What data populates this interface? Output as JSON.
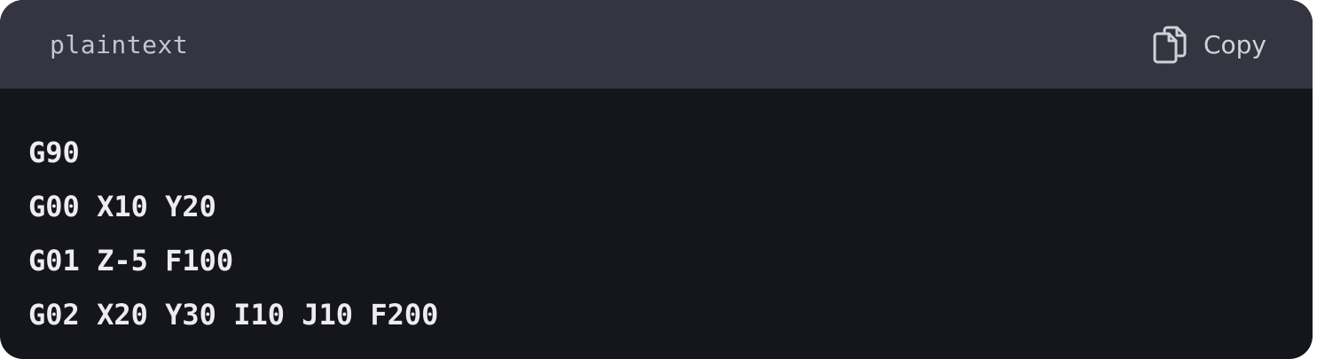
{
  "header": {
    "language": "plaintext",
    "copy_label": "Copy",
    "copy_icon": "copy-icon"
  },
  "code": {
    "lines": [
      "G90",
      "G00 X10 Y20",
      "G01 Z-5 F100",
      "G02 X20 Y30 I10 J10 F200"
    ]
  },
  "colors": {
    "header_bg": "#343541",
    "body_bg": "#15151d",
    "code_text": "#ececf1",
    "muted_text": "#c5c5d2"
  }
}
